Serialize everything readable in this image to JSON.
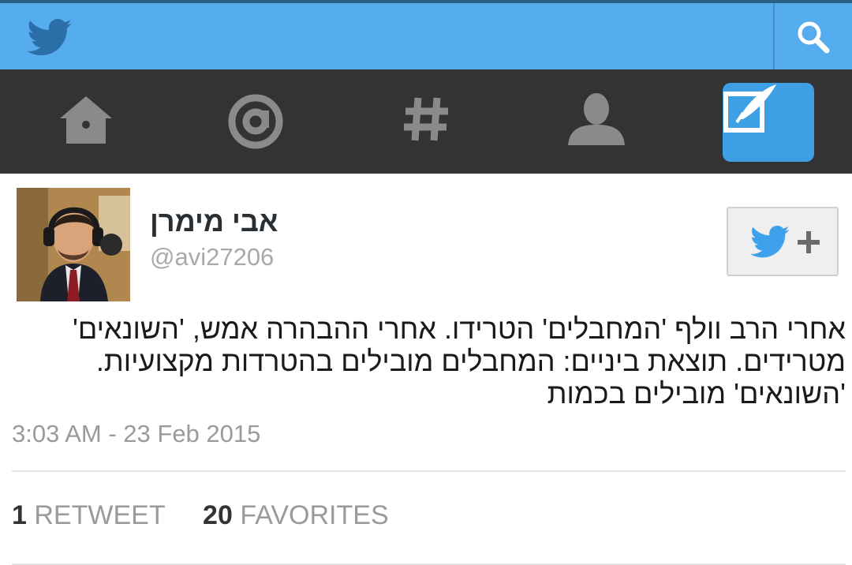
{
  "colors": {
    "brand": "#55acee",
    "nav_background": "#333333",
    "compose_active": "#3d9fe4",
    "text_primary": "#292f33",
    "text_muted": "#9a9a9a"
  },
  "topbar": {
    "logo_icon": "twitter-bird-icon",
    "search_icon": "search-icon"
  },
  "nav": {
    "items": [
      {
        "icon": "home-icon"
      },
      {
        "icon": "mentions-at-icon"
      },
      {
        "icon": "hashtag-discover-icon"
      },
      {
        "icon": "profile-person-icon"
      },
      {
        "icon": "compose-tweet-icon",
        "active": true
      }
    ]
  },
  "tweet": {
    "author": {
      "display_name": "אבי מימרן",
      "handle": "@avi27206"
    },
    "follow_button_icon": "follow-bird-plus-icon",
    "text_lines": [
      "אחרי הרב וולף 'המחבלים' הטרידו. אחרי ההבהרה אמש, 'השונאים'",
      "מטרידים. תוצאת ביניים: המחבלים מובילים בהטרדות מקצועיות.",
      "'השונאים' מובילים בכמות"
    ],
    "timestamp": "3:03 AM - 23 Feb 2015",
    "stats": {
      "retweets_count": "1",
      "retweets_label": "RETWEET",
      "favorites_count": "20",
      "favorites_label": "FAVORITES"
    }
  }
}
